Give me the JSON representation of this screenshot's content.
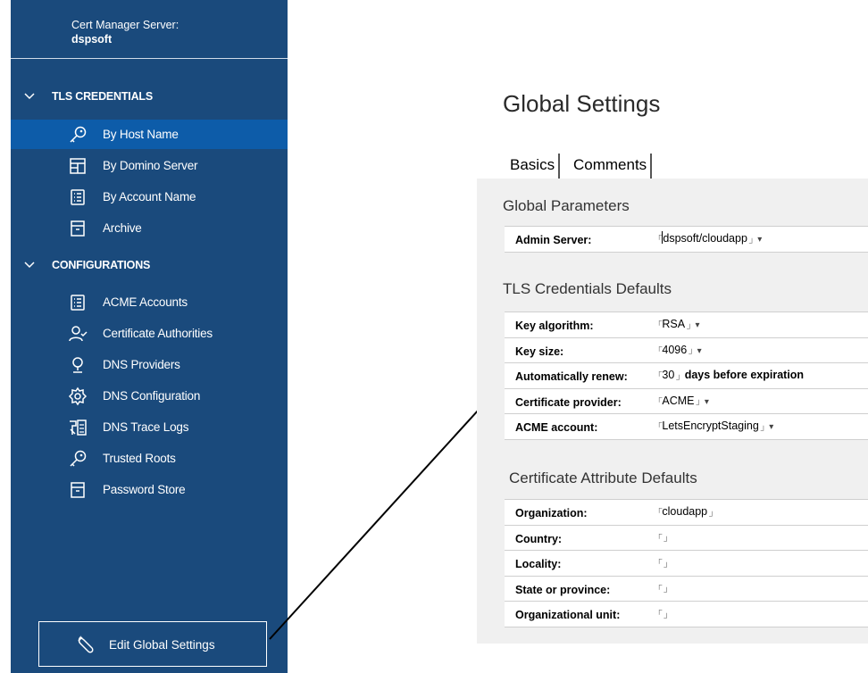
{
  "sidebar": {
    "server_label": "Cert Manager Server:",
    "server_name": "dspsoft",
    "sections": {
      "tls": {
        "title": "TLS CREDENTIALS",
        "items": [
          {
            "label": "By Host Name",
            "icon": "key-icon",
            "active": true
          },
          {
            "label": "By Domino Server",
            "icon": "server-layout-icon"
          },
          {
            "label": "By Account Name",
            "icon": "account-list-icon"
          },
          {
            "label": "Archive",
            "icon": "archive-icon"
          }
        ]
      },
      "config": {
        "title": "CONFIGURATIONS",
        "items": [
          {
            "label": "ACME Accounts",
            "icon": "account-list-icon"
          },
          {
            "label": "Certificate Authorities",
            "icon": "person-check-icon"
          },
          {
            "label": "DNS Providers",
            "icon": "location-pin-icon"
          },
          {
            "label": "DNS Configuration",
            "icon": "gear-icon"
          },
          {
            "label": "DNS Trace Logs",
            "icon": "trace-log-icon"
          },
          {
            "label": "Trusted Roots",
            "icon": "key-icon"
          },
          {
            "label": "Password Store",
            "icon": "archive-icon"
          }
        ]
      }
    },
    "edit_button": {
      "label": "Edit Global Settings",
      "icon": "wrench-icon"
    }
  },
  "main": {
    "title": "Global Settings",
    "tabs": [
      {
        "label": "Basics"
      },
      {
        "label": "Comments"
      }
    ],
    "global_parameters": {
      "title": "Global Parameters",
      "rows": [
        {
          "label": "Admin Server:",
          "value": "dspsoft/cloudapp",
          "dropdown": true
        }
      ]
    },
    "tls_defaults": {
      "title": "TLS Credentials Defaults",
      "rows": [
        {
          "label": "Key algorithm:",
          "value": "RSA",
          "dropdown": true
        },
        {
          "label": "Key size:",
          "value": "4096",
          "dropdown": true
        },
        {
          "label": "Automatically renew:",
          "value": "30",
          "suffix": "days before expiration"
        },
        {
          "label": "Certificate provider:",
          "value": "ACME",
          "dropdown": true
        },
        {
          "label": "ACME account:",
          "value": "LetsEncryptStaging",
          "dropdown": true
        }
      ]
    },
    "cert_defaults": {
      "title": "Certificate Attribute Defaults",
      "rows": [
        {
          "label": "Organization:",
          "value": "cloudapp"
        },
        {
          "label": "Country:",
          "value": ""
        },
        {
          "label": "Locality:",
          "value": ""
        },
        {
          "label": "State or province:",
          "value": ""
        },
        {
          "label": "Organizational unit:",
          "value": ""
        }
      ]
    }
  },
  "colors": {
    "sidebar_bg": "#1a4a7c",
    "active_item_bg": "#0d5ca9",
    "panel_bg": "#f0f0f0"
  }
}
